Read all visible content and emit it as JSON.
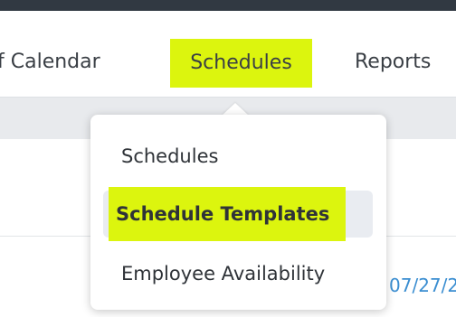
{
  "nav": {
    "items": [
      {
        "label": "f Calendar"
      },
      {
        "label": "Schedules"
      },
      {
        "label": "Reports"
      }
    ]
  },
  "dropdown": {
    "items": [
      {
        "label": "Schedules"
      },
      {
        "label": "Schedule Templates"
      },
      {
        "label": "Employee Availability"
      }
    ]
  },
  "content": {
    "date_partial": "07/27/2"
  },
  "colors": {
    "highlight": "#dcf50e",
    "top_bar": "#313942",
    "link": "#3b8ed1"
  }
}
